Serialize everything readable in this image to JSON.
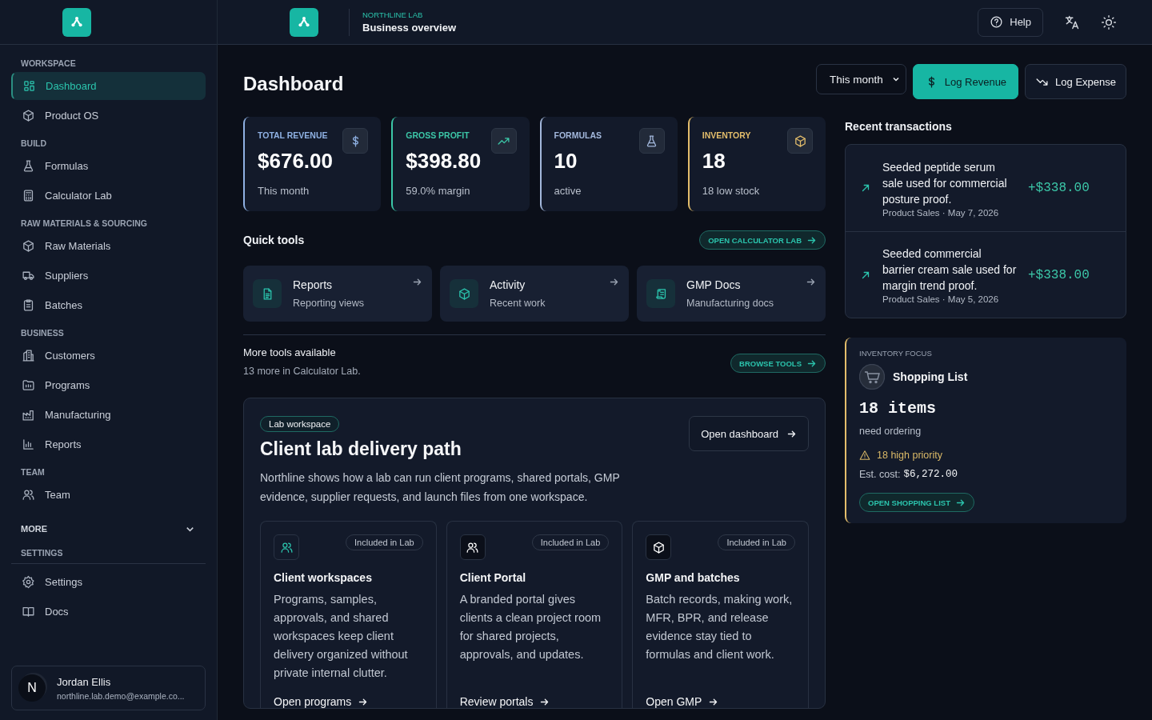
{
  "sidebar": {
    "sections": [
      {
        "heading": "WORKSPACE",
        "items": [
          {
            "label": "Dashboard",
            "selected": true
          },
          {
            "label": "Product OS",
            "selected": false
          }
        ]
      },
      {
        "heading": "BUILD",
        "items": [
          {
            "label": "Formulas",
            "selected": false
          },
          {
            "label": "Calculator Lab",
            "selected": false
          }
        ]
      },
      {
        "heading": "RAW MATERIALS & SOURCING",
        "items": [
          {
            "label": "Raw Materials",
            "selected": false
          },
          {
            "label": "Suppliers",
            "selected": false
          },
          {
            "label": "Batches",
            "selected": false
          }
        ]
      },
      {
        "heading": "BUSINESS",
        "items": [
          {
            "label": "Customers",
            "selected": false
          },
          {
            "label": "Programs",
            "selected": false
          },
          {
            "label": "Manufacturing",
            "selected": false
          },
          {
            "label": "Reports",
            "selected": false
          }
        ]
      },
      {
        "heading": "TEAM",
        "items": [
          {
            "label": "Team",
            "selected": false
          }
        ]
      }
    ],
    "more": {
      "label": "MORE",
      "expanded": false
    },
    "settings": {
      "heading": "SETTINGS",
      "items": [
        {
          "label": "Settings",
          "selected": false
        },
        {
          "label": "Docs",
          "selected": false
        }
      ]
    },
    "user": {
      "initial": "N",
      "name": "Jordan Ellis",
      "email": "northline.lab.demo@example.co..."
    }
  },
  "header": {
    "eyebrow": "NORTHLINE LAB",
    "title": "Business overview",
    "help": "Help"
  },
  "page": {
    "title": "Dashboard",
    "period": "This month",
    "log_revenue": "Log Revenue",
    "log_expense": "Log Expense"
  },
  "stats": [
    {
      "label": "TOTAL REVENUE",
      "value": "$676.00",
      "note": "This month",
      "color": "#8fb1e3"
    },
    {
      "label": "GROSS PROFIT",
      "value": "$398.80",
      "note": "59.0% margin",
      "color": "#3cc7a8"
    },
    {
      "label": "FORMULAS",
      "value": "10",
      "note": "active",
      "color": "#a3b8dc"
    },
    {
      "label": "INVENTORY",
      "value": "18",
      "note": "18 low stock",
      "color": "#e3bd6b"
    }
  ],
  "quick_tools": {
    "title": "Quick tools",
    "action": "OPEN CALCULATOR LAB",
    "items": [
      {
        "title": "Reports",
        "subtitle": "Reporting views"
      },
      {
        "title": "Activity",
        "subtitle": "Recent work"
      },
      {
        "title": "GMP Docs",
        "subtitle": "Manufacturing docs"
      }
    ]
  },
  "more_tools": {
    "title": "More tools available",
    "subtitle": "13 more in Calculator Lab.",
    "action": "BROWSE TOOLS"
  },
  "feature": {
    "badge": "Lab workspace",
    "title": "Client lab delivery path",
    "description": "Northline shows how a lab can run client programs, shared portals, GMP evidence, supplier requests, and launch files from one workspace.",
    "action": "Open dashboard",
    "cards": [
      {
        "highlighted": true,
        "badge": "Included in Lab",
        "title": "Client workspaces",
        "description": "Programs, samples, approvals, and shared workspaces keep client delivery organized without private internal clutter.",
        "link": "Open programs"
      },
      {
        "highlighted": false,
        "badge": "Included in Lab",
        "title": "Client Portal",
        "description": "A branded portal gives clients a clean project room for shared projects, approvals, and updates.",
        "link": "Review portals"
      },
      {
        "highlighted": false,
        "badge": "Included in Lab",
        "title": "GMP and batches",
        "description": "Batch records, making work, MFR, BPR, and release evidence stay tied to formulas and client work.",
        "link": "Open GMP"
      }
    ]
  },
  "transactions": {
    "title": "Recent transactions",
    "items": [
      {
        "description": "Seeded peptide serum sale used for commercial posture proof.",
        "meta": "Product Sales · May 7, 2026",
        "amount": "+$338.00"
      },
      {
        "description": "Seeded commercial barrier cream sale used for margin trend proof.",
        "meta": "Product Sales · May 5, 2026",
        "amount": "+$338.00"
      }
    ]
  },
  "inventory_focus": {
    "eyebrow": "INVENTORY FOCUS",
    "title": "Shopping List",
    "count": "18 items",
    "note": "need ordering",
    "priority": "18 high priority",
    "cost_label": "Est. cost:",
    "cost": "$6,272.00",
    "action": "OPEN SHOPPING LIST"
  }
}
